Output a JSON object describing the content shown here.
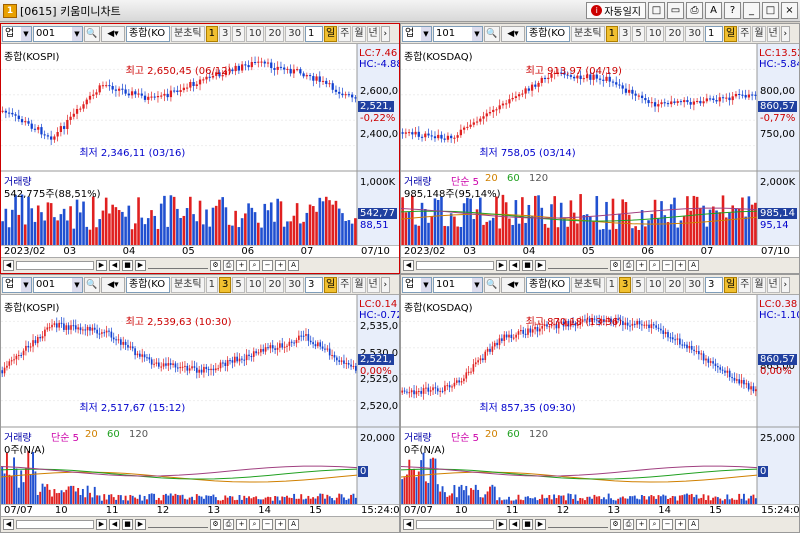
{
  "window": {
    "title": "[0615] 키움미니차트",
    "auto_label": "자동일지",
    "btns": [
      "□",
      "▭",
      "⎙",
      "A",
      "?",
      "_",
      "□",
      "×"
    ]
  },
  "toolbar": {
    "type": "업",
    "period_tabs": [
      "일",
      "주",
      "월",
      "년"
    ],
    "tick_label": "분초틱",
    "ticks": [
      "1",
      "3",
      "5",
      "10",
      "20",
      "30"
    ]
  },
  "panels": [
    {
      "code": "001",
      "market": "종합(KO",
      "tick_count": "1",
      "name": "종합(KOSPI)",
      "lc": "LC:7.46",
      "hc": "HC:-4.88",
      "prices": [
        "2,600,0",
        "2,400,0"
      ],
      "cur": "2,521,",
      "pct": "-0,22%",
      "hi": "최고 2,650,45 (06/12)",
      "lo": "최저 2,346,11 (03/16)",
      "vol_title": "거래량",
      "vol_text": "542,775주(88,51%)",
      "vol_axis": "1,000K",
      "vol_cur": "542,77",
      "vol_pct": "88,51",
      "x": [
        "2023/02",
        "03",
        "04",
        "05",
        "06",
        "07"
      ],
      "x_end": "07/10"
    },
    {
      "code": "101",
      "market": "종합(KO",
      "tick_count": "1",
      "name": "종합(KOSDAQ)",
      "lc": "LC:13.52",
      "hc": "HC:-5.84",
      "prices": [
        "800,00",
        "750,00"
      ],
      "cur": "860,57",
      "pct": "-0,77%",
      "hi": "최고 913,97 (04/19)",
      "lo": "최저 758,05 (03/14)",
      "vol_title": "거래량",
      "ma": [
        "단순 5",
        "20",
        "60",
        "120"
      ],
      "vol_text": "985,148주(95,14%)",
      "vol_axis": "2,000K",
      "vol_cur": "985,14",
      "vol_pct": "95,14",
      "x": [
        "2023/02",
        "03",
        "04",
        "05",
        "06",
        "07"
      ],
      "x_end": "07/10"
    },
    {
      "code": "001",
      "market": "종합(KO",
      "tick_count": "3",
      "name": "종합(KOSPI)",
      "lc": "LC:0.14",
      "hc": "HC:-0.72",
      "prices": [
        "2,535,0",
        "2,530,0",
        "2,525,0",
        "2,520,0"
      ],
      "cur": "2,521,",
      "pct": "0,00%",
      "hi": "최고 2,539,63 (10:30)",
      "lo": "최저 2,517,67 (15:12)",
      "vol_title": "거래량",
      "ma": [
        "단순 5",
        "20",
        "60",
        "120"
      ],
      "vol_text": "0주(N/A)",
      "vol_axis": "20,000",
      "vol_cur": "0",
      "vol_pct": "",
      "x": [
        "07/07",
        "10",
        "11",
        "12",
        "13",
        "14",
        "15"
      ],
      "x_end": "15:24:0"
    },
    {
      "code": "101",
      "market": "종합(KO",
      "tick_count": "3",
      "name": "종합(KOSDAQ)",
      "lc": "LC:0.38",
      "hc": "HC:-1.10",
      "prices": [
        "865,00"
      ],
      "cur": "860,57",
      "pct": "0,00%",
      "hi": "최고 870,18 (13:36)",
      "lo": "최저 857,35 (09:30)",
      "vol_title": "거래량",
      "ma": [
        "단순 5",
        "20",
        "60",
        "120"
      ],
      "vol_text": "0주(N/A)",
      "vol_axis": "25,000",
      "vol_cur": "0",
      "vol_pct": "",
      "x": [
        "07/07",
        "10",
        "11",
        "12",
        "13",
        "14",
        "15"
      ],
      "x_end": "15:24:0"
    }
  ]
}
